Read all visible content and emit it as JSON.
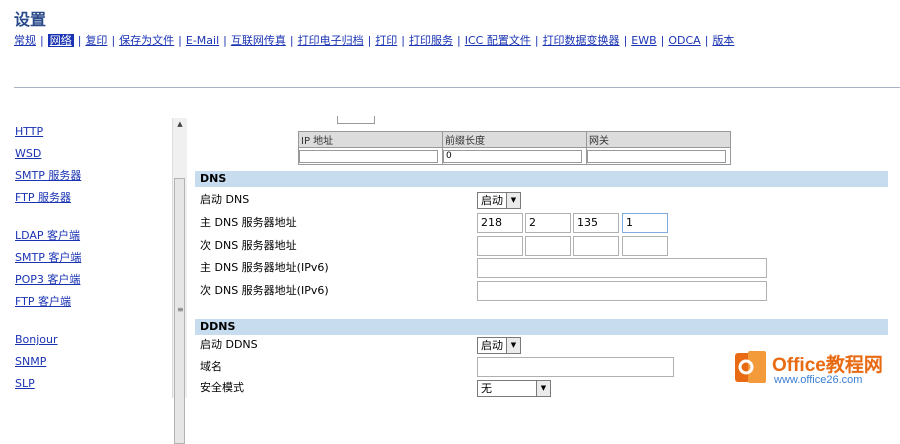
{
  "page_title": "设置",
  "top_nav": [
    {
      "label": "常规",
      "active": false
    },
    {
      "label": "网络",
      "active": true
    },
    {
      "label": "复印",
      "active": false
    },
    {
      "label": "保存为文件",
      "active": false
    },
    {
      "label": "E-Mail",
      "active": false
    },
    {
      "label": "互联网传真",
      "active": false
    },
    {
      "label": "打印电子归档",
      "active": false
    },
    {
      "label": "打印",
      "active": false
    },
    {
      "label": "打印服务",
      "active": false
    },
    {
      "label": "ICC 配置文件",
      "active": false
    },
    {
      "label": "打印数据变换器",
      "active": false
    },
    {
      "label": "EWB",
      "active": false
    },
    {
      "label": "ODCA",
      "active": false
    },
    {
      "label": "版本",
      "active": false
    }
  ],
  "sidebar": {
    "groups": [
      [
        "HTTP",
        "WSD",
        "SMTP 服务器",
        "FTP 服务器"
      ],
      [
        "LDAP 客户端",
        "SMTP 客户端",
        "POP3 客户端",
        "FTP 客户端"
      ],
      [
        "Bonjour",
        "SNMP",
        "SLP"
      ]
    ]
  },
  "ip_table": {
    "headers": [
      "IP 地址",
      "前缀长度",
      "网关"
    ],
    "values": [
      "",
      "0",
      ""
    ]
  },
  "dns": {
    "heading": "DNS",
    "enable_label": "启动 DNS",
    "enable_value": "启动",
    "primary_label": "主 DNS 服务器地址",
    "primary_octets": [
      "218",
      "2",
      "135",
      "1"
    ],
    "secondary_label": "次 DNS 服务器地址",
    "secondary_octets": [
      "",
      "",
      "",
      ""
    ],
    "primary_v6_label": "主 DNS 服务器地址(IPv6)",
    "primary_v6_value": "",
    "secondary_v6_label": "次 DNS 服务器地址(IPv6)",
    "secondary_v6_value": ""
  },
  "ddns": {
    "heading": "DDNS",
    "enable_label": "启动 DDNS",
    "enable_value": "启动",
    "domain_label": "域名",
    "domain_value": "",
    "security_label": "安全模式",
    "security_value": "无"
  },
  "watermark": {
    "brand": "Office教程网",
    "url": "www.office26.com"
  },
  "colors": {
    "link": "#1a33b3",
    "section_header": "#c8dcf0",
    "title": "#2a4a8a",
    "watermark_orange": "#e86a12"
  }
}
